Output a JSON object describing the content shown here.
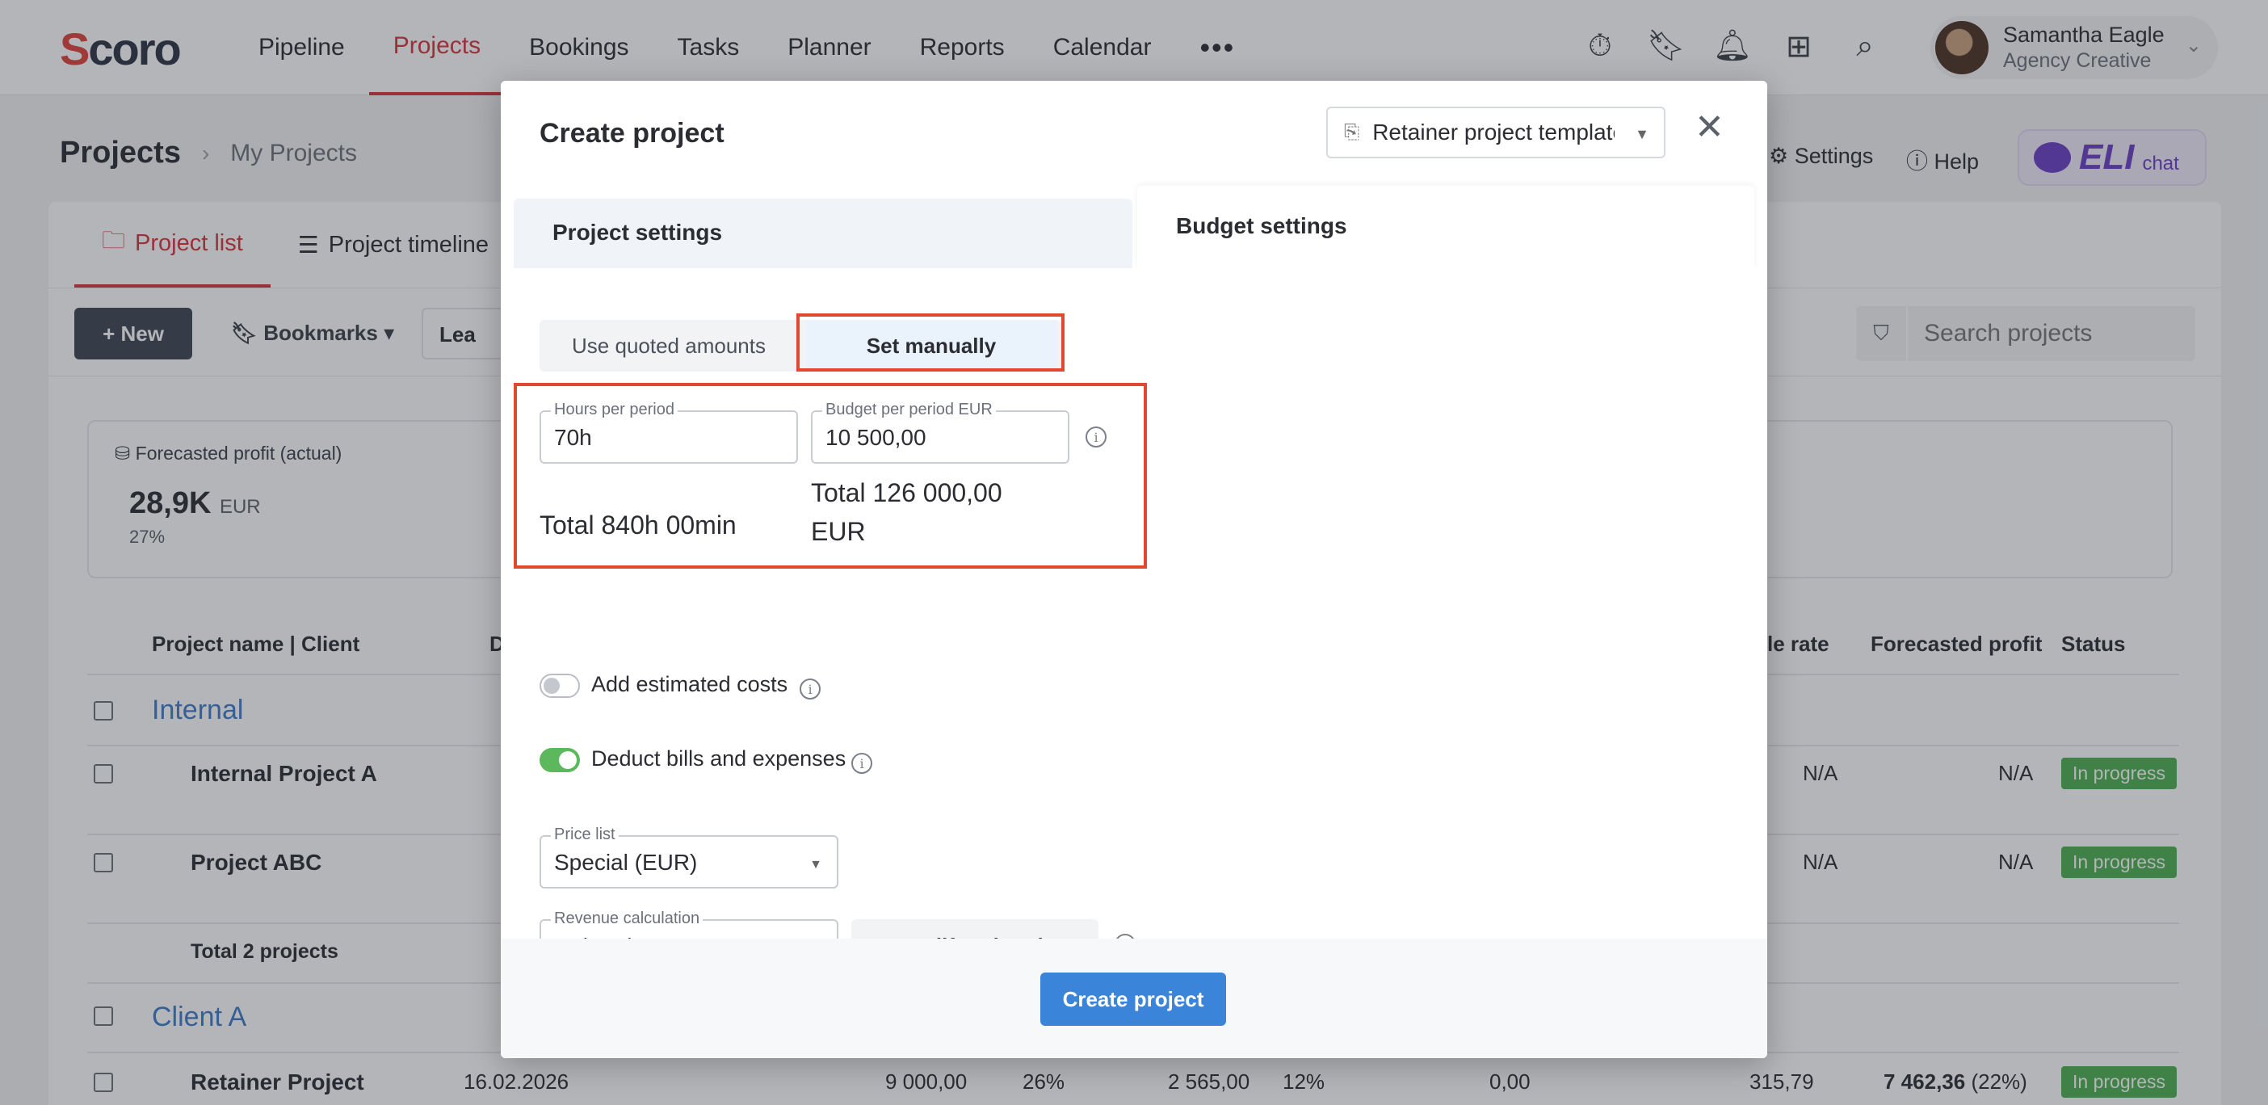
{
  "app": {
    "logo": "Scoro",
    "nav": [
      "Pipeline",
      "Projects",
      "Bookings",
      "Tasks",
      "Planner",
      "Reports",
      "Calendar"
    ],
    "nav_more": "•••",
    "user": {
      "name": "Samantha Eagle",
      "role": "Agency Creative"
    },
    "icons": [
      "timer-icon",
      "bookmark-icon",
      "bell-icon",
      "plus-square-icon",
      "search-icon"
    ]
  },
  "page": {
    "title": "Projects",
    "breadcrumb_sub": "My Projects",
    "settings": "Settings",
    "help": "Help",
    "eli": {
      "name": "ELI",
      "chat": "chat"
    },
    "tabs": [
      "Project list",
      "Project timeline"
    ],
    "toolbar": {
      "new": "+ New",
      "bookmarks": "Bookmarks",
      "lead": "Lea",
      "search_placeholder": "Search projects"
    },
    "profit": {
      "label": "Forecasted profit (actual)",
      "value": "28,9K",
      "currency": "EUR",
      "pct": "27%"
    },
    "table": {
      "headers": {
        "name": "Project name | Client",
        "date": "D",
        "rate": "le rate",
        "profit": "Forecasted profit",
        "status": "Status"
      },
      "groups": [
        {
          "name": "Internal",
          "rows": [
            {
              "name": "Internal Project A",
              "rate": "N/A",
              "profit": "N/A",
              "status": "In progress"
            },
            {
              "name": "Project ABC",
              "rate": "N/A",
              "profit": "N/A",
              "status": "In progress"
            }
          ],
          "total": "Total 2 projects"
        },
        {
          "name": "Client A",
          "rows": [
            {
              "name": "Retainer Project",
              "date": "16.02.2026",
              "v1": "9 000,00",
              "v2": "26%",
              "v3": "2 565,00",
              "v4": "12%",
              "v5": "0,00",
              "rate": "315,79",
              "profit": "7 462,36",
              "profit_pct": "(22%)",
              "status": "In progress"
            }
          ]
        }
      ]
    }
  },
  "modal": {
    "title": "Create project",
    "template": "Retainer project template",
    "left_panel_title": "Project settings",
    "right_panel_title": "Budget settings",
    "segment": {
      "option_a": "Use quoted amounts",
      "option_b": "Set manually",
      "selected": "option_b"
    },
    "hours_per_period": {
      "label": "Hours per period",
      "value": "70h"
    },
    "budget_per_period": {
      "label": "Budget per period EUR",
      "value": "10 500,00"
    },
    "total_hours": "Total 840h 00min",
    "total_budget": "Total 126 000,00 EUR",
    "add_estimated_costs": {
      "label": "Add estimated costs",
      "on": false
    },
    "deduct_bills": {
      "label": "Deduct bills and expenses",
      "on": true
    },
    "price_list": {
      "label": "Price list",
      "value": "Special (EUR)"
    },
    "revenue_calc": {
      "label": "Revenue calculation",
      "value": "Role prices"
    },
    "modify_role_prices": "Modify role prices",
    "create_button": "Create project",
    "colors": {
      "accent": "#3a85d9",
      "highlight": "#e2482f",
      "toggle_on": "#5cb85c"
    }
  }
}
